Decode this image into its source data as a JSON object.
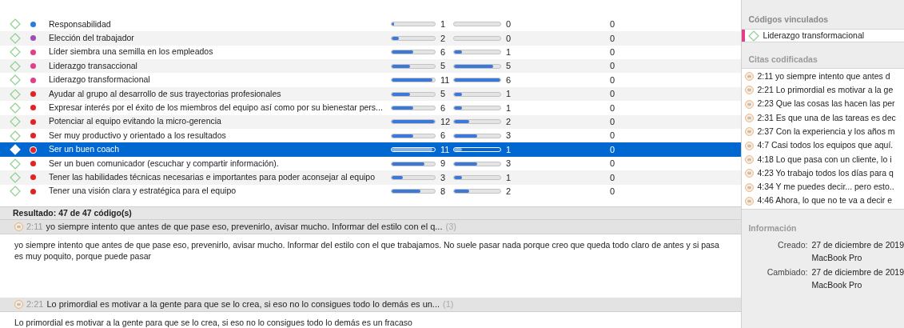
{
  "codes": [
    {
      "name": "Responsabilidad",
      "color": "#2a7be0",
      "selected": false,
      "bar_1": {
        "level": 0.05,
        "count": "1"
      },
      "bar_2": {
        "level": 0,
        "count": "0"
      },
      "column_3": "0"
    },
    {
      "name": "Elección del trabajador",
      "color": "#9b4fb0",
      "selected": false,
      "bar_1": {
        "level": 0.17,
        "count": "2"
      },
      "bar_2": {
        "level": 0,
        "count": "0"
      },
      "column_3": "0"
    },
    {
      "name": "Líder siembra una semilla en los empleados",
      "color": "#e0408a",
      "selected": false,
      "bar_1": {
        "level": 0.5,
        "count": "6"
      },
      "bar_2": {
        "level": 0.17,
        "count": "1"
      },
      "column_3": "0"
    },
    {
      "name": "Liderazgo transaccional",
      "color": "#e0408a",
      "selected": false,
      "bar_1": {
        "level": 0.42,
        "count": "5"
      },
      "bar_2": {
        "level": 0.85,
        "count": "5"
      },
      "column_3": "0"
    },
    {
      "name": "Liderazgo transformacional",
      "color": "#e0408a",
      "selected": false,
      "bar_1": {
        "level": 0.95,
        "count": "11"
      },
      "bar_2": {
        "level": 1,
        "count": "6"
      },
      "column_3": "0"
    },
    {
      "name": "Ayudar al grupo al desarrollo de sus trayectorias profesionales",
      "color": "#e02424",
      "selected": false,
      "bar_1": {
        "level": 0.42,
        "count": "5"
      },
      "bar_2": {
        "level": 0.17,
        "count": "1"
      },
      "column_3": "0"
    },
    {
      "name": "Expresar interés por el éxito de los miembros del equipo así como por su bienestar pers...",
      "color": "#e02424",
      "selected": false,
      "bar_1": {
        "level": 0.5,
        "count": "6"
      },
      "bar_2": {
        "level": 0.17,
        "count": "1"
      },
      "column_3": "0"
    },
    {
      "name": "Potenciar al equipo evitando la micro-gerencia",
      "color": "#e02424",
      "selected": false,
      "bar_1": {
        "level": 1,
        "count": "12"
      },
      "bar_2": {
        "level": 0.33,
        "count": "2"
      },
      "column_3": "0"
    },
    {
      "name": "Ser muy productivo y orientado a los resultados",
      "color": "#e02424",
      "selected": false,
      "bar_1": {
        "level": 0.5,
        "count": "6"
      },
      "bar_2": {
        "level": 0.5,
        "count": "3"
      },
      "column_3": "0"
    },
    {
      "name": "Ser un buen coach",
      "color": "#e02424",
      "selected": true,
      "bar_1": {
        "level": 0.95,
        "count": "11"
      },
      "bar_2": {
        "level": 0.17,
        "count": "1"
      },
      "column_3": "0"
    },
    {
      "name": "Ser un buen comunicador (escuchar y compartir información).",
      "color": "#e02424",
      "selected": false,
      "bar_1": {
        "level": 0.75,
        "count": "9"
      },
      "bar_2": {
        "level": 0.5,
        "count": "3"
      },
      "column_3": "0"
    },
    {
      "name": "Tener las habilidades técnicas necesarias e importantes para poder aconsejar al equipo",
      "color": "#e02424",
      "selected": false,
      "bar_1": {
        "level": 0.25,
        "count": "3"
      },
      "bar_2": {
        "level": 0.17,
        "count": "1"
      },
      "column_3": "0"
    },
    {
      "name": "Tener una visión clara y estratégica para el equipo",
      "color": "#e02424",
      "selected": false,
      "bar_1": {
        "level": 0.67,
        "count": "8"
      },
      "bar_2": {
        "level": 0.33,
        "count": "2"
      },
      "column_3": "0"
    }
  ],
  "result": "Resultado: 47 de 47 código(s)",
  "quotes": [
    {
      "id": "2:11",
      "title": "yo siempre intento que antes de que pase eso, prevenirlo, avisar mucho. Informar del estilo con el q...",
      "count": "(3)",
      "text": "yo siempre intento que antes de que pase eso, prevenirlo, avisar mucho. Informar del estilo con el que trabajamos. No suele pasar nada porque creo que queda todo claro de antes y si pasa es muy poquito, porque puede pasar"
    },
    {
      "id": "2:21",
      "title": "Lo primordial es motivar a la gente para que se lo crea, si eso no lo consigues todo lo demás es un...",
      "count": "(1)",
      "text": "Lo primordial es motivar a la gente para que se lo crea, si eso no lo consigues todo lo demás es un fracaso"
    }
  ],
  "inspector": {
    "linked_codes_heading": "Códigos vinculados",
    "linked_codes": [
      {
        "name": "Liderazgo transformacional",
        "color": "#e0408a"
      }
    ],
    "coded_quotes_heading": "Citas codificadas",
    "coded_quotes": [
      {
        "id": "2:11",
        "text": "yo siempre intento que antes d"
      },
      {
        "id": "2:21",
        "text": "Lo primordial es motivar a la ge"
      },
      {
        "id": "2:23",
        "text": "Que las cosas las hacen las per"
      },
      {
        "id": "2:31",
        "text": "Es que una de las tareas es dec"
      },
      {
        "id": "2:37",
        "text": "Con la experiencia y los años m"
      },
      {
        "id": "4:7",
        "text": "Casi todos los equipos que aquí."
      },
      {
        "id": "4:18",
        "text": "Lo que pasa con un cliente, lo i"
      },
      {
        "id": "4:23",
        "text": "Yo trabajo todos los días para q"
      },
      {
        "id": "4:34",
        "text": "Y me puedes decir... pero esto.."
      },
      {
        "id": "4:46",
        "text": "Ahora, lo que no te va a decir e"
      }
    ],
    "info_heading": "Información",
    "info": [
      {
        "label": "Creado:",
        "lines": [
          "27 de diciembre de 2019",
          "MacBook Pro"
        ]
      },
      {
        "label": "Cambiado:",
        "lines": [
          "27 de diciembre de 2019",
          "MacBook Pro"
        ]
      }
    ]
  }
}
